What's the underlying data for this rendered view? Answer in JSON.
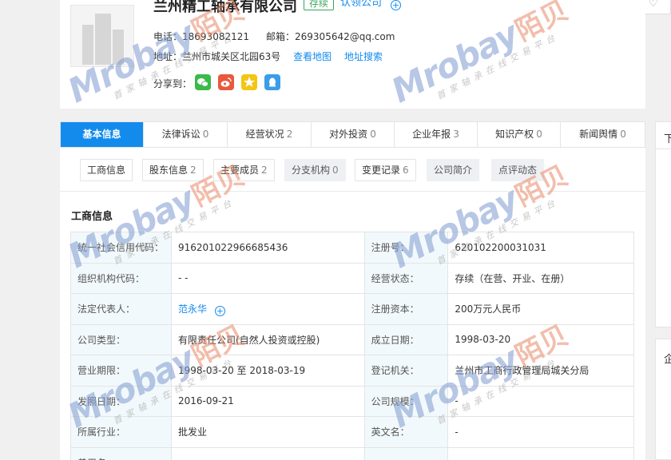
{
  "company": {
    "name": "兰州精工轴承有限公司",
    "status_tag": "存续",
    "claim_label": "认领公司"
  },
  "contact": {
    "phone_label": "电话：",
    "phone": "18693082121",
    "email_label": "邮箱：",
    "email": "269305642@qq.com",
    "address_label": "地址：",
    "address": "兰州市城关区北园63号",
    "view_map": "查看地图",
    "address_search": "地址搜索",
    "share_label": "分享到："
  },
  "share_icons": [
    "wechat-icon",
    "weibo-icon",
    "qzone-icon",
    "qq-icon"
  ],
  "colors": {
    "accent": "#128bed",
    "status_green": "#3aa55b",
    "label_bg": "#f2f9fc"
  },
  "tabs": [
    {
      "label": "基本信息",
      "count": ""
    },
    {
      "label": "法律诉讼",
      "count": "0"
    },
    {
      "label": "经营状况",
      "count": "2"
    },
    {
      "label": "对外投资",
      "count": "0"
    },
    {
      "label": "企业年报",
      "count": "3"
    },
    {
      "label": "知识产权",
      "count": "0"
    },
    {
      "label": "新闻舆情",
      "count": "0"
    }
  ],
  "subtabs": [
    {
      "label": "工商信息",
      "count": ""
    },
    {
      "label": "股东信息",
      "count": "2"
    },
    {
      "label": "主要成员",
      "count": "2"
    },
    {
      "label": "分支机构",
      "count": "0"
    },
    {
      "label": "变更记录",
      "count": "6"
    },
    {
      "label": "公司简介",
      "count": ""
    },
    {
      "label": "点评动态",
      "count": ""
    }
  ],
  "section_title": "工商信息",
  "rows": [
    [
      "统一社会信用代码：",
      "916201022966685436",
      "注册号：",
      "620102200031031"
    ],
    [
      "组织机构代码：",
      "- -",
      "经营状态：",
      "存续（在营、开业、在册）"
    ],
    [
      "法定代表人：",
      "范永华",
      "注册资本：",
      "200万元人民币"
    ],
    [
      "公司类型：",
      "有限责任公司(自然人投资或控股)",
      "成立日期：",
      "1998-03-20"
    ],
    [
      "营业期限：",
      "1998-03-20 至 2018-03-19",
      "登记机关：",
      "兰州市工商行政管理局城关分局"
    ],
    [
      "发照日期：",
      "2016-09-21",
      "公司规模：",
      "-"
    ],
    [
      "所属行业：",
      "批发业",
      "英文名：",
      "-"
    ],
    [
      "曾用名：",
      "",
      "",
      ""
    ]
  ],
  "right_panel": {
    "top_char": "下",
    "bottom_char": "企"
  },
  "watermark": {
    "brand": "Mrobay",
    "cn": "陌贝",
    "tagline": "首家轴承在线交易平台"
  }
}
